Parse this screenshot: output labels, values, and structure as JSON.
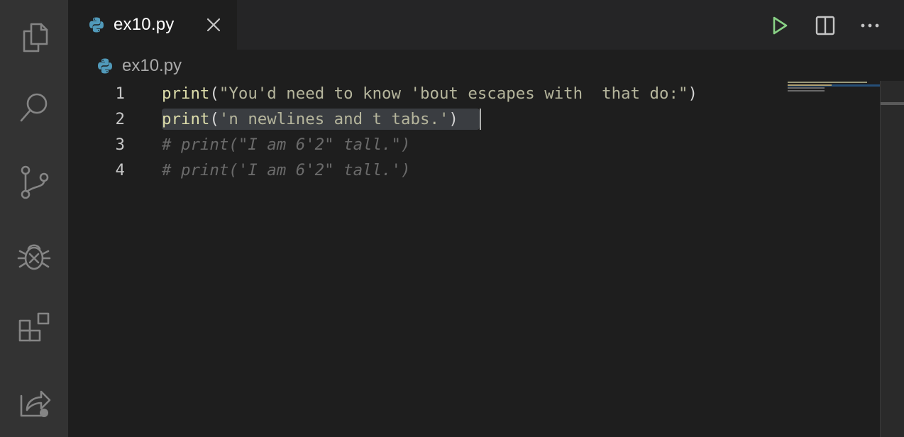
{
  "activity_bar": {
    "items": [
      {
        "name": "explorer",
        "icon": "files-icon"
      },
      {
        "name": "search",
        "icon": "search-icon"
      },
      {
        "name": "source-control",
        "icon": "source-control-icon"
      },
      {
        "name": "run-and-debug",
        "icon": "debug-icon"
      },
      {
        "name": "extensions",
        "icon": "extensions-icon"
      },
      {
        "name": "remote-explorer",
        "icon": "remote-explorer-icon"
      }
    ]
  },
  "tabs": [
    {
      "label": "ex10.py",
      "icon": "python-icon",
      "active": true
    }
  ],
  "breadcrumb": {
    "file": "ex10.py"
  },
  "editor": {
    "lines": [
      {
        "number": "1",
        "fn": "print",
        "open": "(",
        "string": "\"You'd need to know 'bout escapes with  that do:\"",
        "close": ")"
      },
      {
        "number": "2",
        "fn": "print",
        "open": "(",
        "string": "'n newlines and t tabs.'",
        "close": ")"
      },
      {
        "number": "3",
        "comment": "# print(\"I am 6'2\" tall.\")"
      },
      {
        "number": "4",
        "comment": "# print('I am 6'2\" tall.')"
      }
    ]
  },
  "colors": {
    "accent_run": "#89d185",
    "python_blue": "#519aba",
    "function": "#dcdcaa",
    "string": "#ce9178",
    "comment": "#6a6a6a"
  }
}
